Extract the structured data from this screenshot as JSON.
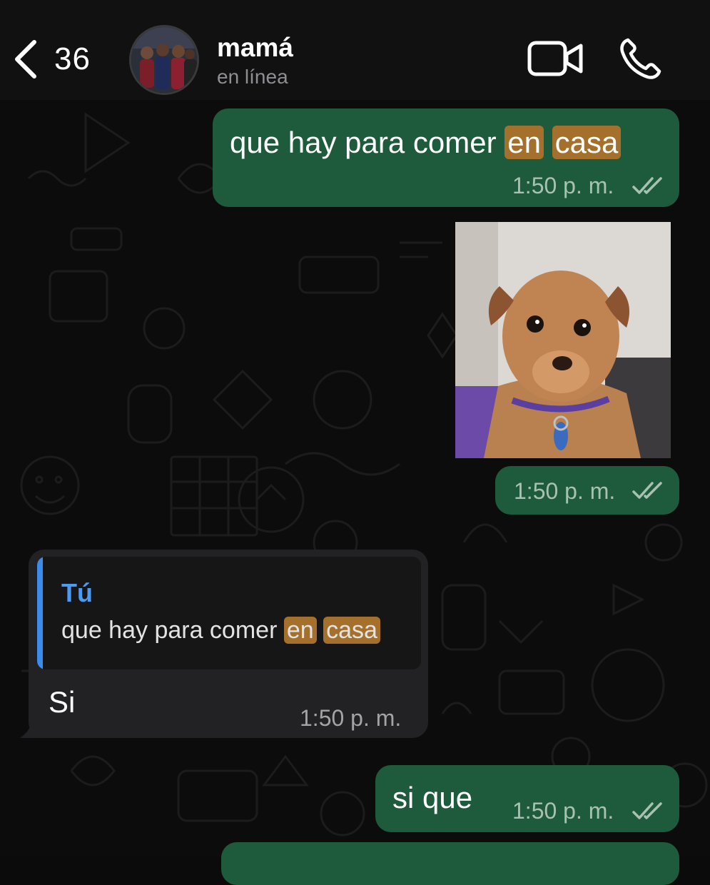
{
  "header": {
    "back_count": "36",
    "contact_name": "mamá",
    "contact_status": "en línea"
  },
  "messages": [
    {
      "type": "outgoing",
      "text_parts": [
        "que hay para comer ",
        "en",
        " ",
        "casa"
      ],
      "time": "1:50 p. m."
    },
    {
      "type": "outgoing-image",
      "image": "photo of a small brown dog",
      "time": "1:50 p. m."
    },
    {
      "type": "incoming-reply",
      "quoted_author": "Tú",
      "quoted_parts": [
        "que hay para comer ",
        "en",
        " ",
        "casa"
      ],
      "text": "Si",
      "time": "1:50 p. m."
    },
    {
      "type": "outgoing",
      "text": "si que",
      "time": "1:50 p. m."
    }
  ],
  "colors": {
    "outgoing_bubble": "#1e5b3c",
    "incoming_bubble": "#222224",
    "search_highlight": "#a5702c",
    "quote_accent": "#3b8ded"
  },
  "icons": {
    "back": "chevron-left-icon",
    "video": "video-camera-icon",
    "call": "phone-icon",
    "read": "double-check-icon"
  }
}
